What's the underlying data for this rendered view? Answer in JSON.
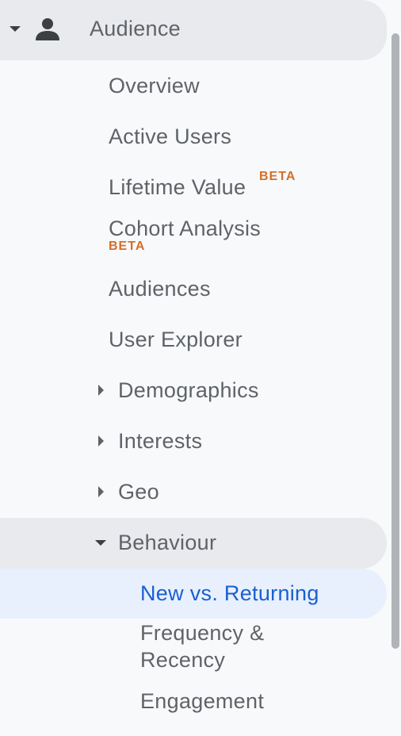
{
  "section": {
    "title": "Audience",
    "icon": "person-icon"
  },
  "items": {
    "overview": "Overview",
    "active_users": "Active Users",
    "lifetime_value": "Lifetime Value",
    "lifetime_value_badge": "BETA",
    "cohort_analysis": "Cohort Analysis",
    "cohort_analysis_badge": "BETA",
    "audiences": "Audiences",
    "user_explorer": "User Explorer",
    "demographics": "Demographics",
    "interests": "Interests",
    "geo": "Geo",
    "behaviour": "Behaviour"
  },
  "behaviour_items": {
    "new_vs_returning": "New vs. Returning",
    "frequency_recency": "Frequency & Recency",
    "frequency_line1": "Frequency &",
    "frequency_line2": "Recency",
    "engagement": "Engagement"
  },
  "colors": {
    "selected_text": "#1a5fd0",
    "selected_bg": "#e8f0fe",
    "beta_badge": "#d56e28",
    "expanded_bg": "#e8eaed"
  }
}
